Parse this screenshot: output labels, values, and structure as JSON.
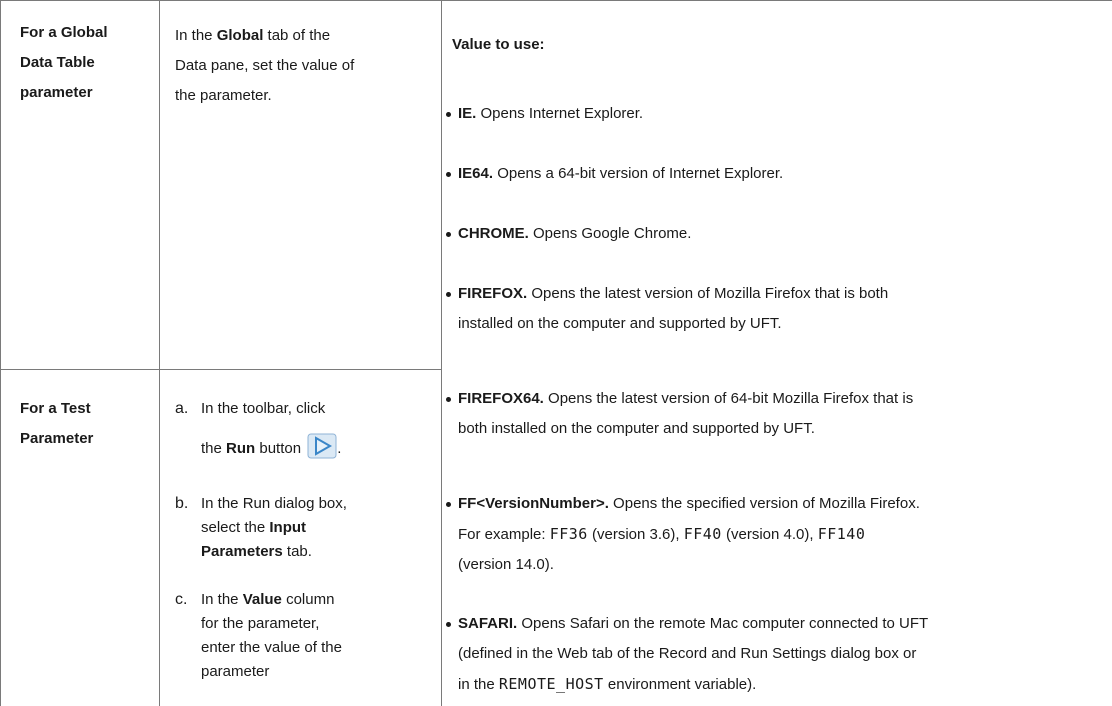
{
  "rows": {
    "global_label_line1": "For a Global",
    "global_label_line2": "Data Table",
    "global_label_line3": "parameter",
    "global_instr_pre": "In the ",
    "global_instr_bold": "Global",
    "global_instr_post1": " tab of the",
    "global_instr_line2": "Data pane, set the value of",
    "global_instr_line3": "the parameter.",
    "test_label_line1": "For a Test",
    "test_label_line2": "Parameter"
  },
  "steps": [
    {
      "letter": "a.",
      "line1": "In the toolbar, click",
      "pre": "the ",
      "bold": "Run",
      "post": " button",
      "end": "."
    },
    {
      "letter": "b.",
      "line1": "In the Run dialog box,",
      "pre": "select the ",
      "bold1": "Input",
      "bold2": "Parameters",
      "post": " tab."
    },
    {
      "letter": "c.",
      "pre": "In the ",
      "bold": "Value",
      "post": " column",
      "line2": "for the parameter,",
      "line3": "enter the value of the",
      "line4": "parameter"
    }
  ],
  "values": {
    "heading": "Value to use:",
    "items": [
      {
        "bold": "IE.",
        "text": " Opens Internet Explorer."
      },
      {
        "bold": "IE64.",
        "text": " Opens a 64-bit version of Internet Explorer."
      },
      {
        "bold": "CHROME.",
        "text": " Opens Google Chrome."
      },
      {
        "bold": "FIREFOX.",
        "text": " Opens the latest version of Mozilla Firefox that is both",
        "text2": "installed on the computer and supported by UFT."
      },
      {
        "bold": "FIREFOX64.",
        "text": " Opens the latest version of 64-bit Mozilla Firefox that is",
        "text2": "both installed on the computer and supported by UFT."
      },
      {
        "bold": "FF<VersionNumber>.",
        "text": " Opens the specified version of Mozilla Firefox.",
        "ex_pre": "For example: ",
        "ex1_code": "FF36",
        "ex1": " (version 3.6), ",
        "ex2_code": "FF40",
        "ex2": " (version 4.0), ",
        "ex3_code": "FF140",
        "ex3": "(version 14.0)."
      },
      {
        "bold": "SAFARI.",
        "text": " Opens Safari on the remote Mac computer connected to UFT",
        "text2": "(defined in the Web tab of the Record and Run Settings dialog box or",
        "text3_pre": "in the ",
        "text3_code": "REMOTE_HOST",
        "text3_post": " environment variable)."
      }
    ]
  },
  "icons": {
    "run": "run-play-icon"
  }
}
